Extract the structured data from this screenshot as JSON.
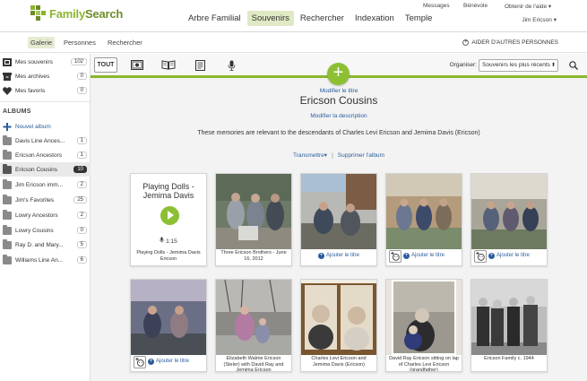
{
  "header": {
    "logo_text_1": "Family",
    "logo_text_2": "Search",
    "nav": [
      "Arbre Familial",
      "Souvenirs",
      "Rechercher",
      "Indexation",
      "Temple"
    ],
    "util": {
      "messages": "Messages",
      "volunteer": "Bénévole",
      "help": "Obtenir de l'aide ▾",
      "user": "Jim Ericson ▾"
    }
  },
  "subnav": {
    "items": [
      "Galerie",
      "Personnes",
      "Rechercher"
    ],
    "help_others": "AIDER D'AUTRES PERSONNES"
  },
  "sidebar": {
    "top": [
      {
        "label": "Mes souvenirs",
        "count": "102",
        "icon": "memories-icon"
      },
      {
        "label": "Mes archives",
        "count": "0",
        "icon": "archive-icon"
      },
      {
        "label": "Mes favoris",
        "count": "0",
        "icon": "heart-icon"
      }
    ],
    "albums_heading": "ALBUMS",
    "new_album": "Nouvel album",
    "albums": [
      {
        "label": "Davis Line Ances...",
        "count": "1"
      },
      {
        "label": "Ericson Ancestors",
        "count": "1"
      },
      {
        "label": "Ericson Cousins",
        "count": "10"
      },
      {
        "label": "Jim Ericson imm...",
        "count": "2"
      },
      {
        "label": "Jim's Favorites",
        "count": "25"
      },
      {
        "label": "Lowry Ancestors",
        "count": "2"
      },
      {
        "label": "Lowry Cousins",
        "count": "0"
      },
      {
        "label": "Ray D. and Mary...",
        "count": "5"
      },
      {
        "label": "Williams Line An...",
        "count": "6"
      }
    ]
  },
  "toolbar": {
    "tab_all": "TOUT",
    "organiser_label": "Organiser:",
    "sort_value": "Souvenirs les plus récents"
  },
  "album": {
    "add_symbol": "+",
    "edit_title": "Modifier le titre",
    "title": "Ericson Cousins",
    "edit_desc": "Modifier la description",
    "description": "These memories are relevant to the descendants of Charles Levi Ericson and Jemima Davis (Ericson)",
    "transmit": "Transmettre▾",
    "delete": "Supprimer l'album"
  },
  "cards": {
    "add_title": "Ajouter le titre",
    "story_title": "Playing Dolls - Jemima Davis",
    "story_duration": "1:15",
    "captions": [
      "Playing Dolls - Jemima Davis Ericson",
      "Three Ericson Brothers - June 16, 2012",
      "Elizabeth Walme Ericson (Steler) with David Ray and Jemima Ericson",
      "Charles Levi Ericson and Jemima Davis (Ericson)",
      "David Ray Ericson sitting on lap of Charles Levi Ericson (grandfather)",
      "Ericson Family c. 1944"
    ]
  }
}
